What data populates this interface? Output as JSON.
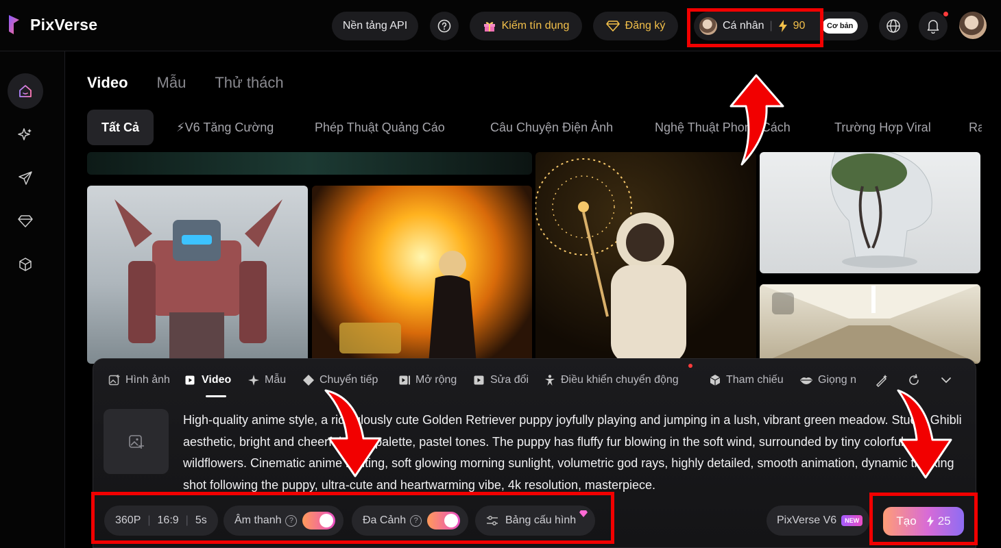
{
  "header": {
    "brand": "PixVerse",
    "api_label": "Nền tảng API",
    "earn_label": "Kiếm tín dụng",
    "subscribe_label": "Đăng ký",
    "account_label": "Cá nhân",
    "credits": "90",
    "plan_badge": "Cơ bản"
  },
  "tabs": [
    "Video",
    "Mẫu",
    "Thử thách"
  ],
  "categories": [
    "Tất Cả",
    "⚡V6 Tăng Cường",
    "Phép Thuật Quảng Cáo",
    "Câu Chuyện Điện Ảnh",
    "Nghệ Thuật Phong Cách",
    "Trường Hợp Viral",
    "Ra"
  ],
  "composer": {
    "tools": [
      "Hình ảnh",
      "Video",
      "Mẫu",
      "Chuyển tiếp",
      "Mở rộng",
      "Sửa đổi",
      "Điều khiển chuyển động",
      "Tham chiếu",
      "Giọng n"
    ],
    "prompt": "High-quality anime style, a ridiculously cute Golden Retriever puppy joyfully playing and jumping in a lush, vibrant green meadow. Studio Ghibli aesthetic, bright and cheerful color palette, pastel tones. The puppy has fluffy fur blowing in the soft wind, surrounded by tiny colorful wildflowers. Cinematic anime lighting, soft glowing morning sunlight, volumetric god rays, highly detailed, smooth animation, dynamic tracking shot following the puppy, ultra-cute and heartwarming vibe, 4k resolution, masterpiece.",
    "resolution": "360P",
    "aspect": "16:9",
    "duration": "5s",
    "audio_label": "Âm thanh",
    "multiscene_label": "Đa Cảnh",
    "config_label": "Bảng cấu hình",
    "model_label": "PixVerse V6",
    "new_badge": "NEW",
    "create_label": "Tạo",
    "create_cost": "25"
  },
  "colors": {
    "accent": "#f3c04a",
    "annotation": "#f20000"
  }
}
